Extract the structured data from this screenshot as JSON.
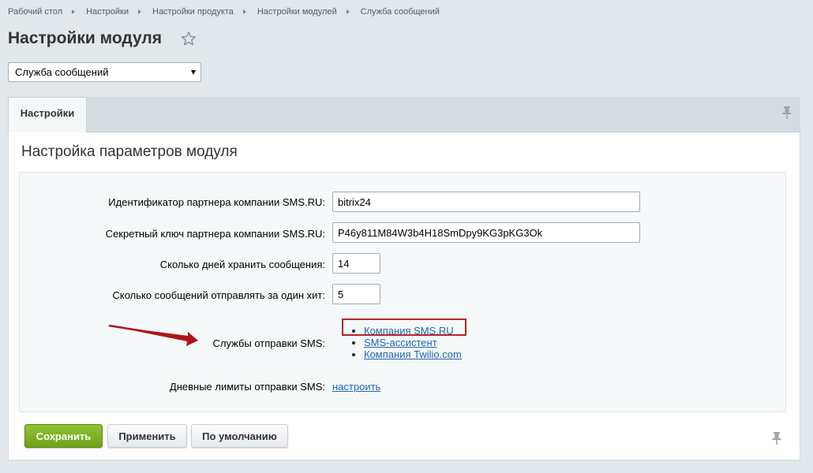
{
  "breadcrumb": {
    "items": [
      "Рабочий стол",
      "Настройки",
      "Настройки продукта",
      "Настройки модулей",
      "Служба сообщений"
    ]
  },
  "page": {
    "title": "Настройки модуля"
  },
  "module_select": {
    "value": "Служба сообщений"
  },
  "tabs": [
    {
      "label": "Настройки"
    }
  ],
  "section": {
    "title": "Настройка параметров модуля"
  },
  "form": {
    "partner_id": {
      "label": "Идентификатор партнера компании SMS.RU:",
      "value": "bitrix24"
    },
    "partner_key": {
      "label": "Секретный ключ партнера компании SMS.RU:",
      "value": "P46y811M84W3b4H18SmDpy9KG3pKG3Ok"
    },
    "days_keep": {
      "label": "Сколько дней хранить сообщения:",
      "value": "14"
    },
    "per_hit": {
      "label": "Сколько сообщений отправлять за один хит:",
      "value": "5"
    },
    "services": {
      "label": "Службы отправки SMS:",
      "items": [
        "Компания SMS.RU",
        "SMS-ассистент",
        "Компания Twilio.com"
      ]
    },
    "daily_limits": {
      "label": "Дневные лимиты отправки SMS:",
      "link": "настроить"
    }
  },
  "buttons": {
    "save": "Сохранить",
    "apply": "Применить",
    "default": "По умолчанию"
  },
  "colors": {
    "accent_green": "#7bb123",
    "link_blue": "#2067b0",
    "highlight_red": "#b8242a",
    "arrow_red": "#b0141a"
  },
  "icons": {
    "favorite": "star-icon",
    "pin": "pin-icon"
  }
}
